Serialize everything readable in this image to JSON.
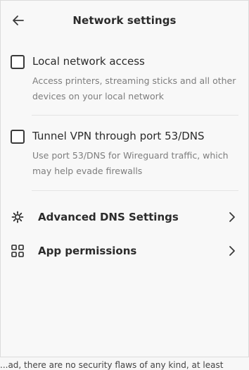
{
  "header": {
    "title": "Network settings",
    "back_icon": "arrow-left-icon"
  },
  "options": [
    {
      "label": "Local network access",
      "description": "Access printers, streaming sticks and all other devices on your local network",
      "checked": false
    },
    {
      "label": "Tunnel VPN through port 53/DNS",
      "description": "Use port 53/DNS for Wireguard traffic, which may help evade firewalls",
      "checked": false
    }
  ],
  "nav_items": [
    {
      "label": "Advanced DNS Settings",
      "icon": "gear-icon"
    },
    {
      "label": "App permissions",
      "icon": "grid-icon"
    }
  ],
  "background_text": "...ad, there are no security flaws of any kind, at least"
}
